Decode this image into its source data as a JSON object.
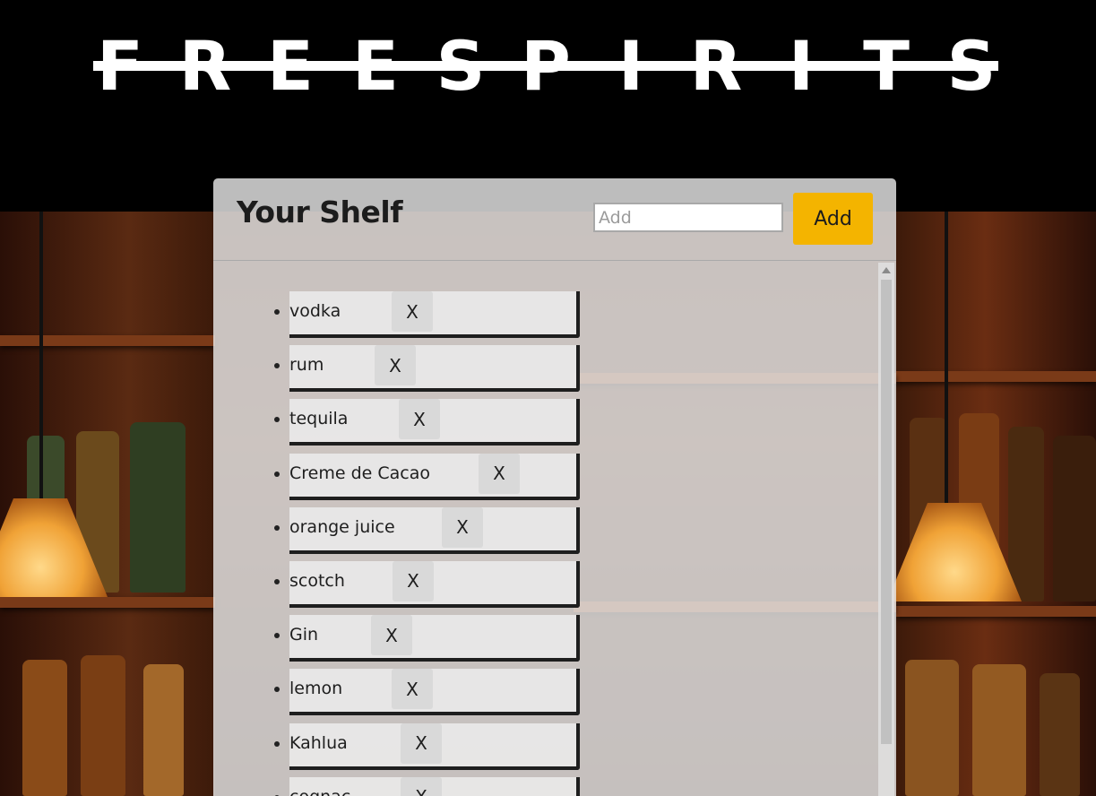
{
  "header": {
    "logo_text": "FREESPIRITS",
    "logo_letters": [
      "F",
      "R",
      "E",
      "E",
      "S",
      "P",
      "I",
      "R",
      "I",
      "T",
      "S"
    ]
  },
  "shelf": {
    "title": "Your Shelf",
    "add_placeholder": "Add",
    "add_value": "",
    "add_button_label": "Add",
    "remove_label": "X",
    "items": [
      {
        "label": "vodka"
      },
      {
        "label": "rum"
      },
      {
        "label": "tequila"
      },
      {
        "label": "Creme de Cacao"
      },
      {
        "label": "orange juice"
      },
      {
        "label": "scotch"
      },
      {
        "label": "Gin"
      },
      {
        "label": "lemon"
      },
      {
        "label": "Kahlua"
      },
      {
        "label": "cognac"
      }
    ]
  },
  "colors": {
    "header_bg": "#000000",
    "panel_bg": "#ececec",
    "accent": "#f4b400",
    "text": "#1e1e1e"
  },
  "icons": {
    "scroll_up": "triangle-up-icon",
    "list_bullet": "bullet-icon"
  }
}
